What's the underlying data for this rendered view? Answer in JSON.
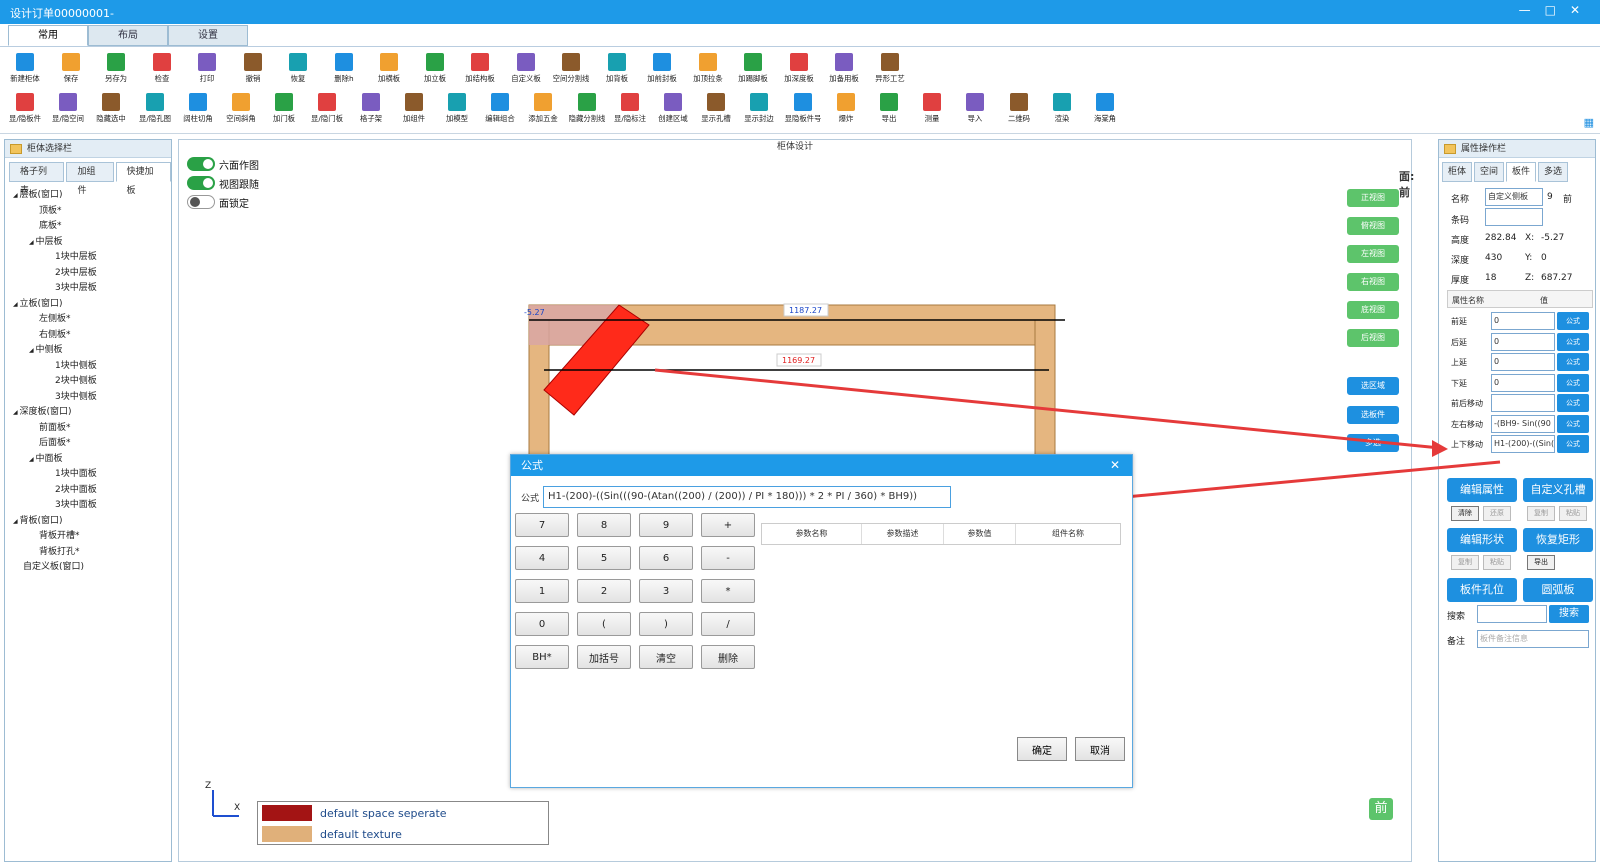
{
  "window": {
    "title": "设计订单00000001-"
  },
  "main_tabs": [
    "常用",
    "布局",
    "设置"
  ],
  "toolbar_row1": [
    "新建柜体",
    "保存",
    "另存为",
    "检查",
    "打印",
    "撤销",
    "恢复",
    "删除h",
    "加横板",
    "加立板",
    "加结构板",
    "自定义板",
    "空间分割线",
    "加背板",
    "加前封板",
    "加顶拉条",
    "加踢脚板",
    "加深度板",
    "加备用板",
    "异形工艺"
  ],
  "toolbar_row2": [
    "显/隐板件",
    "显/隐空间",
    "隐藏选中",
    "显/隐孔图",
    "阔柱切角",
    "空间斜角",
    "加门板",
    "显/隐门板",
    "格子架",
    "加组件",
    "加模型",
    "编辑组合",
    "添加五金",
    "隐藏分割线",
    "显/隐标注",
    "创建区域",
    "显示孔槽",
    "显示封边",
    "显隐板件号",
    "爆炸",
    "导出",
    "测量",
    "导入",
    "二维码",
    "渲染",
    "海棠角"
  ],
  "left_panel": {
    "title": "柜体选择栏",
    "tabs": [
      "格子列表",
      "加组件",
      "快捷加板"
    ],
    "tree": [
      "层板(窗口)",
      "顶板*",
      "底板*",
      "中层板",
      "1块中层板",
      "2块中层板",
      "3块中层板",
      "立板(窗口)",
      "左侧板*",
      "右侧板*",
      "中侧板",
      "1块中侧板",
      "2块中侧板",
      "3块中侧板",
      "深度板(窗口)",
      "前面板*",
      "后面板*",
      "中面板",
      "1块中面板",
      "2块中面板",
      "3块中面板",
      "背板(窗口)",
      "背板开槽*",
      "背板打孔*",
      "自定义板(窗口)"
    ]
  },
  "center": {
    "title": "柜体设计",
    "toggles": [
      {
        "label": "六面作图",
        "on": true
      },
      {
        "label": "视图跟随",
        "on": true
      },
      {
        "label": "面锁定",
        "on": false
      }
    ],
    "face_label": "面:前",
    "view_buttons": [
      "正视图",
      "俯视图",
      "左视图",
      "右视图",
      "底视图",
      "后视图"
    ],
    "action_buttons": [
      "选区域",
      "选板件",
      "多选"
    ],
    "dims": {
      "offset": "-5.27",
      "top": "1187.27",
      "mid": "1169.27"
    },
    "axis": {
      "z": "Z",
      "x": "X"
    },
    "legend": [
      "default space seperate",
      "default texture"
    ],
    "cube_label": "前"
  },
  "dialog": {
    "title": "公式",
    "formula_label": "公式",
    "formula_value": "H1-(200)-((Sin(((90-(Atan((200) / (200)) / PI * 180))) * 2 * PI / 360) * BH9))",
    "keys": [
      "7",
      "8",
      "9",
      "+",
      "4",
      "5",
      "6",
      "-",
      "1",
      "2",
      "3",
      "*",
      "0",
      "(",
      ")",
      "/",
      "BH*",
      "加括号",
      "清空",
      "删除"
    ],
    "table_headers": [
      "参数名称",
      "参数描述",
      "参数值",
      "组件名称"
    ],
    "ok": "确定",
    "cancel": "取消"
  },
  "right_panel": {
    "title": "属性操作栏",
    "tabs": [
      "柜体",
      "空间",
      "板件",
      "多选"
    ],
    "name_label": "名称",
    "name_value": "自定义侧板",
    "name_num": "9",
    "name_face": "前",
    "code_label": "条码",
    "height_label": "高度",
    "height_value": "282.84",
    "x_label": "X:",
    "x_value": "-5.27",
    "depth_label": "深度",
    "depth_value": "430",
    "y_label": "Y:",
    "y_value": "0",
    "thick_label": "厚度",
    "thick_value": "18",
    "z_label": "Z:",
    "z_value": "687.27",
    "prop_header": [
      "属性名称",
      "值"
    ],
    "props": [
      {
        "name": "前延",
        "value": "0"
      },
      {
        "name": "后延",
        "value": "0"
      },
      {
        "name": "上延",
        "value": "0"
      },
      {
        "name": "下延",
        "value": "0"
      },
      {
        "name": "前后移动",
        "value": ""
      },
      {
        "name": "左右移动",
        "value": "-(BH9- Sin((90"
      },
      {
        "name": "上下移动",
        "value": "H1-(200)-((Sin("
      }
    ],
    "formula_btn": "公式",
    "btn_edit_attr": "编辑属性",
    "btn_custom_hole": "自定义孔槽",
    "btn_clear": "清除",
    "btn_restore": "还原",
    "btn_copy": "复制",
    "btn_paste": "粘贴",
    "btn_edit_shape": "编辑形状",
    "btn_restore_rect": "恢复矩形",
    "btn_copy2": "复制",
    "btn_paste2": "粘贴",
    "btn_export": "导出",
    "btn_holes": "板件孔位",
    "btn_arc": "圆弧板",
    "search_label": "搜索",
    "search_btn": "搜索",
    "note_label": "备注",
    "note_placeholder": "板件备注信息"
  },
  "colors": {
    "accent": "#1e9ae8",
    "green": "#5dc46b",
    "selected": "#ff2a1a",
    "wood": "#e5b680"
  }
}
